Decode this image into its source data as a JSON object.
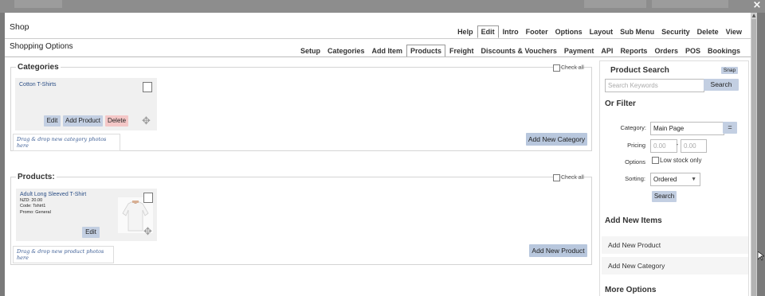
{
  "close_glyph": "×",
  "window": {
    "app_title": "Shop",
    "section_title": "Shopping Options"
  },
  "top_menu": [
    "Help",
    "Edit",
    "Intro",
    "Footer",
    "Options",
    "Layout",
    "Sub Menu",
    "Security",
    "Delete",
    "View"
  ],
  "top_menu_active": "Edit",
  "sub_nav": [
    "Setup",
    "Categories",
    "Add Item",
    "Products",
    "Freight",
    "Discounts & Vouchers",
    "Payment",
    "API",
    "Reports",
    "Orders",
    "POS",
    "Bookings"
  ],
  "sub_nav_active": "Products",
  "categories_panel": {
    "title": "Categories",
    "check_all": "Check all",
    "tile": {
      "name": "Cotton T-Shirts",
      "edit": "Edit",
      "add_product": "Add Product",
      "delete": "Delete"
    },
    "drop_hint": "Drag & drop new category photos here",
    "add_button": "Add New Category"
  },
  "products_panel": {
    "title": "Products:",
    "check_all": "Check all",
    "tile": {
      "name": "Adult Long Sleeved T-Shirt",
      "price": "NZD: 20.00",
      "code": "Code: Tshirt1",
      "promo": "Promo: General",
      "edit": "Edit"
    },
    "drop_hint": "Drag & drop new product photos here",
    "add_button": "Add New Product"
  },
  "product_search": {
    "title": "Product Search",
    "snap": "Snap",
    "keywords_placeholder": "Search Keywords",
    "search_button": "Search",
    "or_filter": "Or Filter",
    "category_label": "Category:",
    "category_value": "Main Page",
    "equals_button": "=",
    "pricing_label": "Pricing",
    "price_min_placeholder": "0.00",
    "price_sep": "-",
    "price_max_placeholder": "0.00",
    "options_label": "Options",
    "low_stock_label": "Low stock only",
    "sorting_label": "Sorting:",
    "sorting_value": "Ordered",
    "filter_search_button": "Search"
  },
  "add_new_items": {
    "title": "Add New Items",
    "items": [
      "Add New Product",
      "Add New Category"
    ]
  },
  "more_options": {
    "title": "More Options"
  },
  "icons": {
    "move": "move-arrows-icon",
    "close": "close-icon",
    "dropdown": "chevron-down-icon",
    "cursor": "mouse-pointer-icon"
  }
}
